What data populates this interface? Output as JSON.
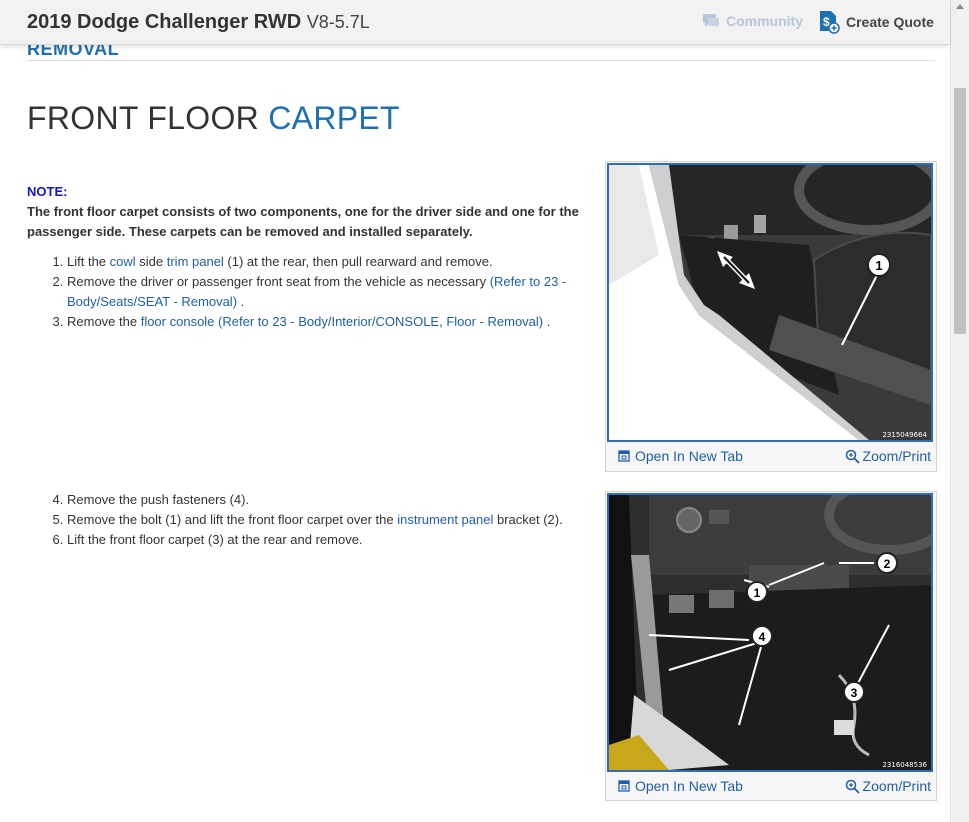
{
  "header": {
    "vehicle": "2019 Dodge Challenger RWD",
    "engine": "V8-5.7L",
    "community_label": "Community",
    "quote_label": "Create Quote",
    "community_icon": "chat-bubble-icon",
    "quote_icon": "quote-dollar-icon"
  },
  "section": {
    "heading": "REMOVAL",
    "title_part1": "FRONT FLOOR",
    "title_part2": "CARPET"
  },
  "note": {
    "label": "NOTE:",
    "text": "The front floor carpet consists of two components, one for the driver side and one for the passenger side. These carpets can be removed and installed separately."
  },
  "steps1": {
    "s1_a": "Lift the ",
    "s1_link1": "cowl",
    "s1_b": " side ",
    "s1_link2": "trim panel",
    "s1_c": " (1) at the rear, then pull rearward and remove.",
    "s2_a": "Remove the driver or passenger front seat from the vehicle as necessary ",
    "s2_link": "(Refer to 23 - Body/Seats/SEAT - Removal)",
    "s2_b": " .",
    "s3_a": "Remove the ",
    "s3_link": "floor console (Refer to 23 - Body/Interior/CONSOLE, Floor - Removal)",
    "s3_b": " ."
  },
  "steps2": {
    "s4": "Remove the push fasteners (4).",
    "s5_a": "Remove the bolt (1) and lift the front floor carpet over the ",
    "s5_link": "instrument panel",
    "s5_b": " bracket (2).",
    "s6": "Lift the front floor carpet (3) at the rear and remove."
  },
  "figures": [
    {
      "code": "2315049664",
      "callouts": [
        "1"
      ],
      "open_label": "Open In New Tab",
      "zoom_label": "Zoom/Print"
    },
    {
      "code": "2316048536",
      "callouts": [
        "1",
        "2",
        "3",
        "4"
      ],
      "open_label": "Open In New Tab",
      "zoom_label": "Zoom/Print"
    }
  ],
  "colors": {
    "accent": "#1f6fb2",
    "link": "#1f5fa8",
    "note_label": "#1515c8",
    "figure_border": "#2f6db5"
  }
}
